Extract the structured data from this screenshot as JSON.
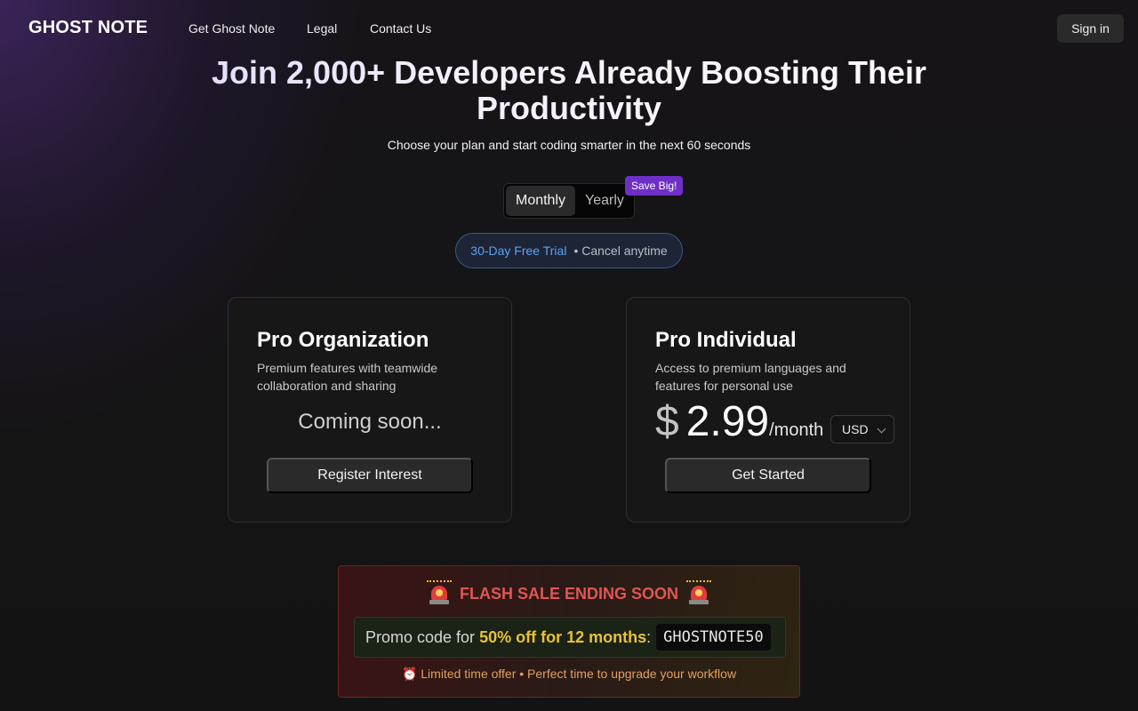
{
  "nav": {
    "logo": "GHOST NOTE",
    "links": [
      "Get Ghost Note",
      "Legal",
      "Contact Us"
    ],
    "signin": "Sign in"
  },
  "hero": {
    "title_line1": "Join 2,000+ Developers Already Boosting Their",
    "title_line2": "Productivity",
    "subtitle": "Choose your plan and start coding smarter in the next 60 seconds"
  },
  "billing_toggle": {
    "options": [
      "Monthly",
      "Yearly"
    ],
    "selected": "Monthly",
    "badge": "Save Big!"
  },
  "trial": {
    "main": "30-Day Free Trial",
    "secondary": "• Cancel anytime"
  },
  "plans": [
    {
      "title": "Pro Organization",
      "description": "Premium features with teamwide collaboration and sharing",
      "status": "Coming soon...",
      "button": "Register Interest"
    },
    {
      "title": "Pro Individual",
      "description": "Access to premium languages and features for personal use",
      "currency_symbol": "$",
      "price": "2.99",
      "period": "/month",
      "currency": "USD",
      "button": "Get Started"
    }
  ],
  "flash_sale": {
    "title": "FLASH SALE ENDING SOON",
    "icon": "siren-icon",
    "promo_prefix": "Promo code for",
    "promo_highlight": "50% off for 12 months",
    "promo_code": "GHOSTNOTE50",
    "footer": "⏰ Limited time offer • Perfect time to upgrade your workflow"
  },
  "colors": {
    "accent_purple": "#6d2fc6",
    "trial_blue": "#5ea2f2",
    "flash_red": "#e05555",
    "promo_gold": "#e7c23a"
  }
}
